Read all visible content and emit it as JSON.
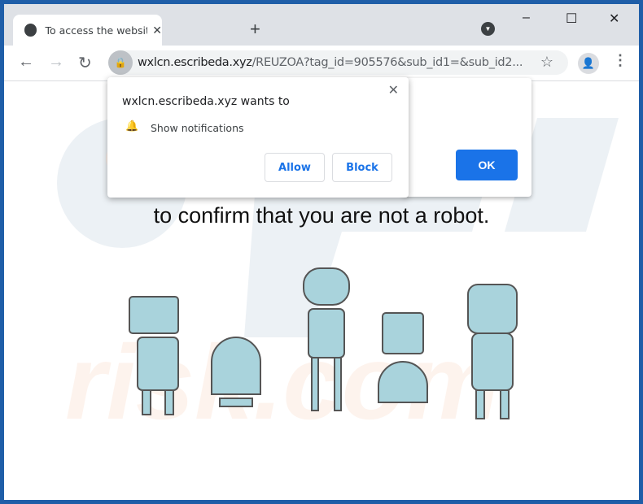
{
  "tab": {
    "title": "To access the website click the \"A",
    "close": "✕",
    "new_tab": "+"
  },
  "window": {
    "minimize": "–",
    "maximize": "☐",
    "close": "✕"
  },
  "toolbar": {
    "back": "←",
    "forward": "→",
    "reload": "↻",
    "url_domain": "wxlcn.escribeda.xyz",
    "url_path": "/REUZOA?tag_id=905576&sub_id1=&sub_id2...",
    "star": "☆",
    "menu": "⋮"
  },
  "permission": {
    "title": "wxlcn.escribeda.xyz wants to",
    "item": "Show notifications",
    "allow": "Allow",
    "block": "Block",
    "close": "✕"
  },
  "page": {
    "ok": "OK",
    "headline": "to confirm that you are not a robot.",
    "robot_color": "#a9d3dc"
  }
}
